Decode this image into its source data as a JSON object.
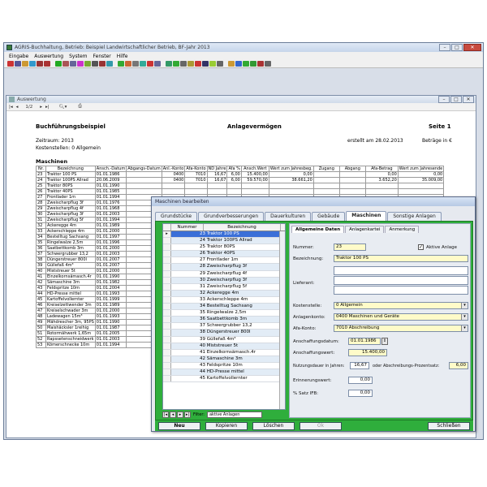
{
  "app": {
    "title": "AGRIS-Buchhaltung, Betrieb: Beispiel Landwirtschaftlicher Betrieb, BF-Jahr 2013",
    "menu": [
      "Eingabe",
      "Auswertung",
      "System",
      "Fenster",
      "Hilfe"
    ]
  },
  "child": {
    "title": "Auswertung",
    "page": "1/2"
  },
  "report": {
    "title": "Buchführungsbeispiel",
    "subtitle": "Anlagevermögen",
    "page": "Seite 1",
    "zeitraum": "Zeitraum: 2013",
    "created": "erstellt am 28.02.2013",
    "betraege": "Beträge in €",
    "kostenstellen": "Kostenstellen: 0 Allgemein",
    "section": "Maschinen",
    "columns": [
      "Nr.",
      "Bezeichnung",
      "Ansch.-Datum",
      "Abgangs-Datum",
      "Anl.-Konto",
      "Afa-Konto",
      "ND Jahre",
      "Afa %",
      "Ansch.Wert",
      "Wert zum Jahresbeg.",
      "Zugang",
      "Abgang",
      "Afa-Betrag",
      "Wert zum Jahresende"
    ],
    "rows": [
      [
        "23",
        "Traktor 100 PS",
        "01.01.1986",
        "",
        "0400",
        "7010",
        "16,67",
        "6,00",
        "15.400,00",
        "0,00",
        "",
        "",
        "0,00",
        "0,00"
      ],
      [
        "24",
        "Traktor 100PS Allrad",
        "20.06.2009",
        "",
        "0400",
        "7010",
        "16,67",
        "6,00",
        "59.570,00",
        "38.661,20",
        "",
        "",
        "3.652,20",
        "35.009,00"
      ],
      [
        "25",
        "Traktor 80PS",
        "01.01.1990",
        "",
        "",
        "",
        "",
        "",
        "",
        "",
        "",
        "",
        "",
        ""
      ],
      [
        "26",
        "Traktor 40PS",
        "01.01.1985",
        "",
        "",
        "",
        "",
        "",
        "",
        "",
        "",
        "",
        "",
        ""
      ],
      [
        "27",
        "Frontlader 1m",
        "01.01.1994",
        "",
        "",
        "",
        "",
        "",
        "",
        "",
        "",
        "",
        "",
        ""
      ],
      [
        "28",
        "Zweischarpflug 3f",
        "01.01.1976",
        "",
        "",
        "",
        "",
        "",
        "",
        "",
        "",
        "",
        "",
        ""
      ],
      [
        "29",
        "Zweischarpflug 4f",
        "01.01.1968",
        "",
        "",
        "",
        "",
        "",
        "",
        "",
        "",
        "",
        "",
        ""
      ],
      [
        "30",
        "Zweischarpflug 3f",
        "01.01.2003",
        "",
        "",
        "",
        "",
        "",
        "",
        "",
        "",
        "",
        "",
        ""
      ],
      [
        "31",
        "Zweischarpflug 5f",
        "01.01.1994",
        "",
        "",
        "",
        "",
        "",
        "",
        "",
        "",
        "",
        "",
        ""
      ],
      [
        "32",
        "Ackeregge 4m",
        "01.01.1989",
        "",
        "",
        "",
        "",
        "",
        "",
        "",
        "",
        "",
        "",
        ""
      ],
      [
        "33",
        "Ackerschleppe 4m",
        "01.01.2000",
        "",
        "",
        "",
        "",
        "",
        "",
        "",
        "",
        "",
        "",
        ""
      ],
      [
        "34",
        "Bestelltug Sachsang",
        "01.01.1997",
        "",
        "",
        "",
        "",
        "",
        "",
        "",
        "",
        "",
        "",
        ""
      ],
      [
        "35",
        "Ringelwalze 2,5m",
        "01.01.1996",
        "",
        "",
        "",
        "",
        "",
        "",
        "",
        "",
        "",
        "",
        ""
      ],
      [
        "36",
        "Saatbettkomb 3m",
        "01.01.2000",
        "",
        "",
        "",
        "",
        "",
        "",
        "",
        "",
        "",
        "",
        ""
      ],
      [
        "37",
        "Schwergrubber 13,2",
        "01.01.2003",
        "",
        "",
        "",
        "",
        "",
        "",
        "",
        "",
        "",
        "",
        ""
      ],
      [
        "38",
        "Düngerstreuer 800l",
        "01.01.2007",
        "",
        "",
        "",
        "",
        "",
        "",
        "",
        "",
        "",
        "",
        ""
      ],
      [
        "39",
        "Güllefaß 4m³",
        "01.01.2007",
        "",
        "",
        "",
        "",
        "",
        "",
        "",
        "",
        "",
        "",
        ""
      ],
      [
        "40",
        "Miststreuer 5t",
        "01.01.2000",
        "",
        "",
        "",
        "",
        "",
        "",
        "",
        "",
        "",
        "",
        ""
      ],
      [
        "41",
        "Einzelkornsämasch.4r",
        "01.01.1990",
        "",
        "",
        "",
        "",
        "",
        "",
        "",
        "",
        "",
        "",
        ""
      ],
      [
        "42",
        "Sämaschine 3m",
        "01.01.1982",
        "",
        "",
        "",
        "",
        "",
        "",
        "",
        "",
        "",
        "",
        ""
      ],
      [
        "43",
        "Feldspritze 10m",
        "01.01.2004",
        "",
        "",
        "",
        "",
        "",
        "",
        "",
        "",
        "",
        "",
        ""
      ],
      [
        "44",
        "HD-Presse mittel",
        "01.01.1993",
        "",
        "",
        "",
        "",
        "",
        "",
        "",
        "",
        "",
        "",
        ""
      ],
      [
        "45",
        "Kartoffelvollernter",
        "01.01.1999",
        "",
        "",
        "",
        "",
        "",
        "",
        "",
        "",
        "",
        "",
        ""
      ],
      [
        "46",
        "Kreiselzettwender 3m",
        "01.01.1989",
        "",
        "",
        "",
        "",
        "",
        "",
        "",
        "",
        "",
        "",
        ""
      ],
      [
        "47",
        "Kreiselschwader 3m",
        "01.01.2000",
        "",
        "",
        "",
        "",
        "",
        "",
        "",
        "",
        "",
        "",
        ""
      ],
      [
        "48",
        "Ladewagen 15m³",
        "01.01.1993",
        "",
        "",
        "",
        "",
        "",
        "",
        "",
        "",
        "",
        "",
        ""
      ],
      [
        "49",
        "Mähdrescher 3m, 95PS",
        "01.01.1990",
        "",
        "",
        "",
        "",
        "",
        "",
        "",
        "",
        "",
        "",
        ""
      ],
      [
        "50",
        "Maishäcksler 1reihig",
        "01.01.1987",
        "",
        "",
        "",
        "",
        "",
        "",
        "",
        "",
        "",
        "",
        ""
      ],
      [
        "51",
        "Rotormähwerk 1,65m",
        "01.01.2005",
        "",
        "",
        "",
        "",
        "",
        "",
        "",
        "",
        "",
        "",
        ""
      ],
      [
        "52",
        "Rapssetenschneidwerk",
        "01.01.2003",
        "",
        "",
        "",
        "",
        "",
        "",
        "",
        "",
        "",
        "",
        ""
      ],
      [
        "53",
        "Kömerschnecke 10m",
        "01.01.1994",
        "",
        "",
        "",
        "",
        "",
        "",
        "",
        "",
        "",
        "",
        ""
      ]
    ]
  },
  "dialog": {
    "title": "Maschinen bearbeiten",
    "tabs": [
      "Grundstücke",
      "Grundverbesserungen",
      "Dauerkulturen",
      "Gebäude",
      "Maschinen",
      "Sonstige Anlagen"
    ],
    "active_tab": "Maschinen",
    "list_headers": [
      "Nummer",
      "Bezeichnung"
    ],
    "list_items": [
      "23 Traktor 100 PS",
      "24 Traktor 100PS Allrad",
      "25 Traktor 80PS",
      "26 Traktor 40PS",
      "27 Frontlader 1m",
      "28 Zweischarpflug 3f",
      "29 Zweischarpflug 4f",
      "30 Zweischarpflug 3f",
      "31 Zweischarpflug 5f",
      "32 Ackeregge 4m",
      "33 Ackerschleppe 4m",
      "34 Bestelltug Sachsang",
      "35 Ringelwalze 2,5m",
      "36 Saatbettkomb 3m",
      "37 Schwergrubber 13,2",
      "38 Düngerstreuer 800l",
      "39 Güllefaß 4m³",
      "40 Miststreuer 5t",
      "41 Einzelkornsämasch.4r",
      "42 Sämaschine 3m",
      "43 Feldspritze 10m",
      "44 HD-Presse mittel",
      "45 Kartoffelvollernter"
    ],
    "filter": "aktive Anlagen",
    "filter_label": "Filter:",
    "subtabs": [
      "Allgemeine Daten",
      "Anlagenkartei",
      "Anmerkung"
    ],
    "fields": {
      "nummer_label": "Nummer:",
      "nummer": "23",
      "aktiv_label": "Aktive Anlage",
      "bezeichnung_label": "Bezeichnung:",
      "bezeichnung": "Traktor 100 PS",
      "lieferant_label": "Lieferant:",
      "kostenstelle_label": "Kostenstelle:",
      "kostenstelle": "0 Allgemein",
      "anlagenkonto_label": "Anlagenkonto:",
      "anlagenkonto": "0400 Maschinen und Geräte",
      "afakonto_label": "Afa-Konto:",
      "afakonto": "7010 Abschreibung",
      "anschaffungsdatum_label": "Anschaffungsdatum:",
      "anschaffungsdatum": "01.01.1986",
      "anschaffungswert_label": "Anschaffungswert:",
      "anschaffungswert": "15.400,00",
      "nutzungsdauer_label": "Nutzungsdauer in Jahren:",
      "nutzungsdauer": "16,67",
      "prozentsatz_label": "oder Abschreibungs-Prozentsatz:",
      "prozentsatz": "6,00",
      "erinnerung_label": "Erinnerungswert:",
      "erinnerung": "0,00",
      "satz_label": "% Satz IFB:",
      "satz": "0,00"
    },
    "buttons": [
      "Neu",
      "Kopieren",
      "Löschen",
      "Ok",
      "Schließen"
    ]
  },
  "colors": {
    "green": "#2fae3c",
    "selection": "#3a6fd8"
  }
}
